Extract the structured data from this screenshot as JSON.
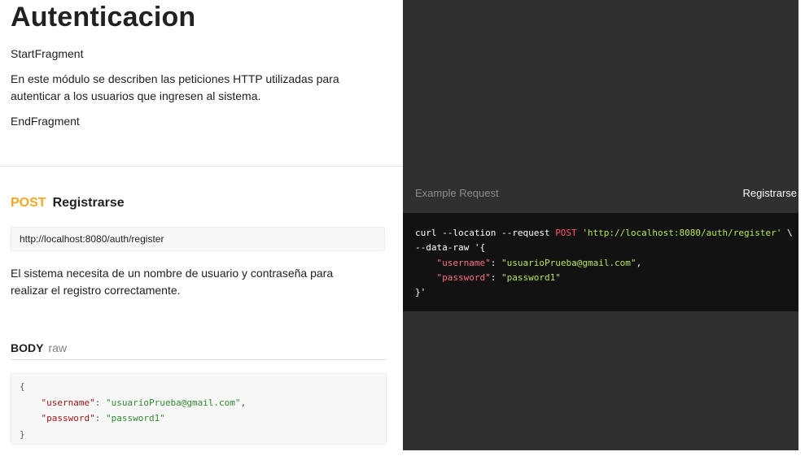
{
  "doc": {
    "title": "Autenticacion",
    "start_fragment": "StartFragment",
    "description": "En este módulo se describen las peticiones HTTP utilizadas para autenticar a los usuarios que ingresen al sistema.",
    "end_fragment": "EndFragment"
  },
  "request": {
    "method": "POST",
    "name": "Registrarse",
    "url": "http://localhost:8080/auth/register",
    "description": "El sistema necesita de un nombre de usuario y contraseña para realizar el registro correctamente.",
    "body_label": "BODY",
    "body_mode": "raw",
    "body_lines": {
      "open": "{",
      "l1_key": "\"username\"",
      "l1_sep": ": ",
      "l1_val": "\"usuarioPrueba@gmail.com\"",
      "l1_end": ",",
      "l2_key": "\"password\"",
      "l2_sep": ": ",
      "l2_val": "\"password1\"",
      "close": "}"
    }
  },
  "example": {
    "label": "Example Request",
    "name": "Registrarse",
    "code": {
      "c1_a": "curl --location --request ",
      "c1_method": "POST",
      "c1_sp": " ",
      "c1_url": "'http://localhost:8080/auth/register'",
      "c1_end": " \\",
      "c2": "--data-raw '{",
      "c3_key": "\"username\"",
      "c3_sep": ": ",
      "c3_val": "\"usuarioPrueba@gmail.com\"",
      "c3_end": ",",
      "c4_key": "\"password\"",
      "c4_sep": ": ",
      "c4_val": "\"password1\"",
      "c5": "}'"
    }
  },
  "colors": {
    "method": "#f5a623",
    "dark_panel": "#303030",
    "code_bg": "#121212"
  }
}
